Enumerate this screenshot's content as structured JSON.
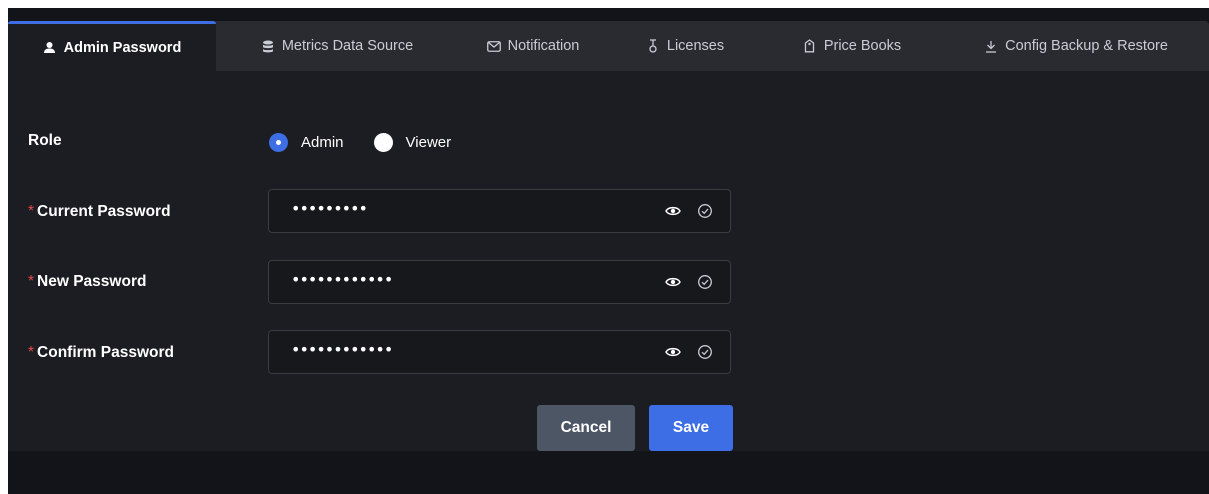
{
  "tabs": [
    {
      "label": "Admin Password",
      "icon": "user-icon",
      "active": true
    },
    {
      "label": "Metrics Data Source",
      "icon": "database-icon",
      "active": false
    },
    {
      "label": "Notification",
      "icon": "mail-icon",
      "active": false
    },
    {
      "label": "Licenses",
      "icon": "key-icon",
      "active": false
    },
    {
      "label": "Price Books",
      "icon": "tag-icon",
      "active": false
    },
    {
      "label": "Config Backup & Restore",
      "icon": "download-icon",
      "active": false
    }
  ],
  "form": {
    "role": {
      "label": "Role",
      "options": [
        {
          "label": "Admin",
          "checked": true
        },
        {
          "label": "Viewer",
          "checked": false
        }
      ]
    },
    "current_password": {
      "label": "Current Password",
      "required_mark": "*",
      "value": "•••••••••"
    },
    "new_password": {
      "label": "New Password",
      "required_mark": "*",
      "value": "••••••••••••"
    },
    "confirm_password": {
      "label": "Confirm Password",
      "required_mark": "*",
      "value": "••••••••••••"
    }
  },
  "actions": {
    "cancel_label": "Cancel",
    "save_label": "Save"
  },
  "colors": {
    "accent": "#3d6ee6",
    "panel": "#1c1d22",
    "tabbar": "#292b31",
    "required": "#e5484d",
    "cancel_button": "#4d5664"
  }
}
